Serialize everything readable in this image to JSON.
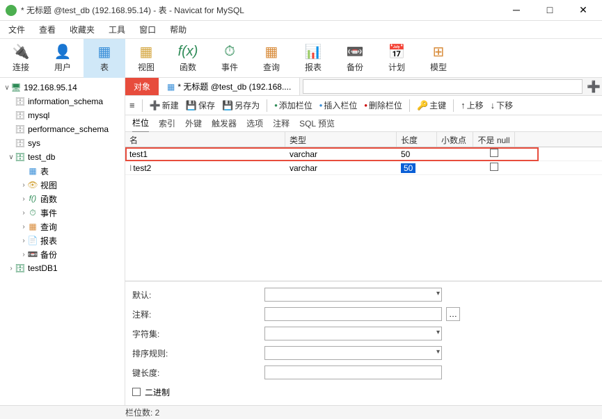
{
  "window": {
    "title": "* 无标题 @test_db (192.168.95.14) - 表 - Navicat for MySQL"
  },
  "menu": {
    "file": "文件",
    "view": "查看",
    "favorites": "收藏夹",
    "tools": "工具",
    "window": "窗口",
    "help": "帮助"
  },
  "toolbar": {
    "connect": "连接",
    "user": "用户",
    "table": "表",
    "view": "视图",
    "function": "函数",
    "event": "事件",
    "query": "查询",
    "report": "报表",
    "backup": "备份",
    "schedule": "计划",
    "model": "模型"
  },
  "tree": {
    "server": "192.168.95.14",
    "dbs": {
      "info_schema": "information_schema",
      "mysql": "mysql",
      "perf_schema": "performance_schema",
      "sys": "sys",
      "test_db": "test_db",
      "testDB1": "testDB1"
    },
    "nodes": {
      "table": "表",
      "view": "视图",
      "function": "函数",
      "event": "事件",
      "query": "查询",
      "report": "报表",
      "backup": "备份"
    }
  },
  "tabs": {
    "objects": "对象",
    "untitled": "* 无标题 @test_db (192.168...."
  },
  "cmd": {
    "new": "新建",
    "save": "保存",
    "saveas": "另存为",
    "addfield": "添加栏位",
    "insfield": "插入栏位",
    "delfield": "删除栏位",
    "pk": "主键",
    "up": "上移",
    "down": "下移"
  },
  "subtabs": {
    "fields": "栏位",
    "index": "索引",
    "fk": "外键",
    "trigger": "触发器",
    "options": "选项",
    "comment": "注释",
    "sqlpreview": "SQL 预览"
  },
  "grid": {
    "hdr": {
      "name": "名",
      "type": "类型",
      "len": "长度",
      "dec": "小数点",
      "notnull": "不是 null"
    },
    "rows": [
      {
        "name": "test1",
        "type": "varchar",
        "len": "50"
      },
      {
        "name": "test2",
        "type": "varchar",
        "len": "50"
      }
    ]
  },
  "props": {
    "default": "默认:",
    "comment": "注释:",
    "charset": "字符集:",
    "collation": "排序规则:",
    "keylen": "键长度:",
    "binary": "二进制"
  },
  "status": {
    "fieldcount": "栏位数: 2"
  }
}
